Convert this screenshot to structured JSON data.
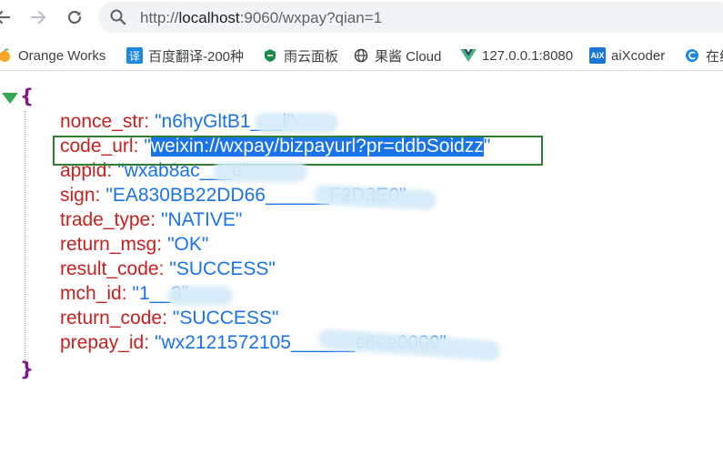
{
  "browser": {
    "url_scheme": "http://",
    "url_host": "localhost",
    "url_rest": ":9060/wxpay?qian=1",
    "nav_icons": {
      "back": "back-arrow-icon",
      "forward": "forward-arrow-icon",
      "reload": "reload-icon",
      "site_info": "search-icon"
    }
  },
  "bookmarks": [
    {
      "label": "Orange Works",
      "icon": "orange-icon"
    },
    {
      "label": "百度翻译-200种",
      "icon": "translate-icon",
      "icon_text": "译"
    },
    {
      "label": "雨云面板",
      "icon": "rainyun-icon"
    },
    {
      "label": "果酱 Cloud",
      "icon": "globe-icon"
    },
    {
      "label": "127.0.0.1:8080",
      "icon": "vue-icon"
    },
    {
      "label": "aiXcoder",
      "icon": "aixcoder-icon",
      "icon_text": "AiX"
    },
    {
      "label": "在线",
      "icon": "c-icon"
    }
  ],
  "json_view": {
    "open_brace": "{",
    "close_brace": "}",
    "colon": ":",
    "fields": [
      {
        "key": "nonce_str",
        "value": "\"n6hyGltB1___l\""
      },
      {
        "key": "code_url",
        "value_quote_open": "\"",
        "value": "weixin://wxpay/bizpayurl?pr=ddbSoidzz",
        "value_quote_close": "\""
      },
      {
        "key": "appid",
        "value": "\"wxab8ac___e\""
      },
      {
        "key": "sign",
        "value": "\"EA830BB22DD66______F2D3E0\""
      },
      {
        "key": "trade_type",
        "value": "\"NATIVE\""
      },
      {
        "key": "return_msg",
        "value": "\"OK\""
      },
      {
        "key": "result_code",
        "value": "\"SUCCESS\""
      },
      {
        "key": "mch_id",
        "value": "\"1__3\""
      },
      {
        "key": "return_code",
        "value": "\"SUCCESS\""
      },
      {
        "key": "prepay_id",
        "value": "\"wx2121572105______e6ee0000\""
      }
    ]
  },
  "colors": {
    "key": "#c5221f",
    "string_value": "#1a73e8",
    "brace": "#881391",
    "selection": "#1a73e8",
    "highlight_border": "#2e7d32"
  }
}
